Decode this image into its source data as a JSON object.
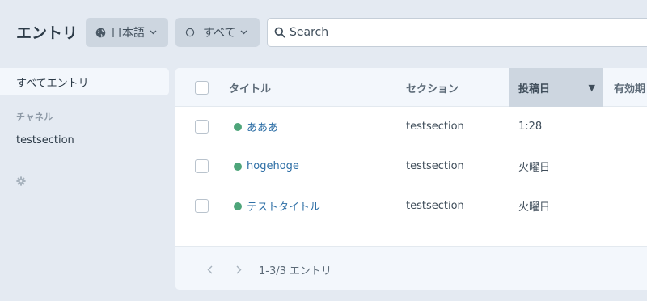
{
  "header": {
    "title": "エントリ",
    "site_menu": {
      "label": "日本語",
      "icon": "globe-icon"
    },
    "status_menu": {
      "label": "すべて",
      "icon": "status-circle-icon"
    },
    "search": {
      "placeholder": "Search",
      "value": ""
    }
  },
  "sidebar": {
    "all_entries": "すべてエントリ",
    "heading": "チャネル",
    "sections": [
      {
        "label": "testsection"
      }
    ],
    "settings_icon": "gear-icon"
  },
  "table": {
    "columns": {
      "title": "タイトル",
      "section": "セクション",
      "post_date": "投稿日",
      "expiry_date": "有効期"
    },
    "sort_indicator": "▼",
    "rows": [
      {
        "title": "あああ",
        "section": "testsection",
        "post_date": "1:28"
      },
      {
        "title": "hogehoge",
        "section": "testsection",
        "post_date": "火曜日"
      },
      {
        "title": "テストタイトル",
        "section": "testsection",
        "post_date": "火曜日"
      }
    ]
  },
  "pagination": {
    "info": "1-3/3 エントリ"
  },
  "colors": {
    "background": "#e4eaf2",
    "button": "#cdd6e0",
    "link": "#2e6fa6",
    "status_live": "#4ea57a"
  }
}
